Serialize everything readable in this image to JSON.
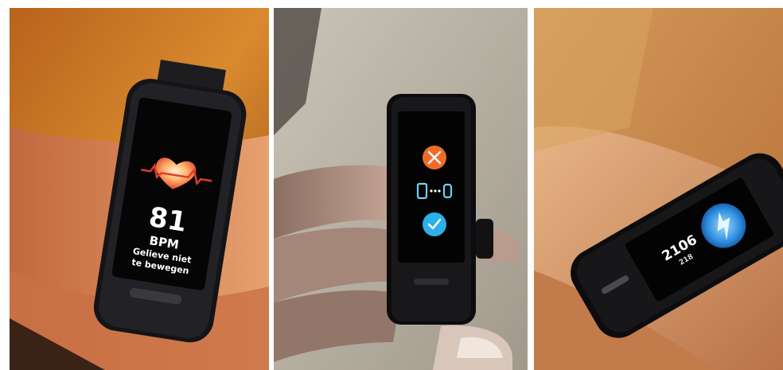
{
  "photos": [
    {
      "screen": "heart-rate",
      "value": "81",
      "unit": "BPM",
      "message_line1": "Gelieve niet",
      "message_line2": "te bewegen"
    },
    {
      "screen": "pairing-confirm",
      "icons": [
        "close-icon",
        "phone-band-pair-icon",
        "check-icon"
      ],
      "colors": {
        "decline": "#f26a2a",
        "accept": "#2ab0ea"
      }
    },
    {
      "screen": "steps",
      "value": "2106",
      "sub_value": "218"
    }
  ]
}
